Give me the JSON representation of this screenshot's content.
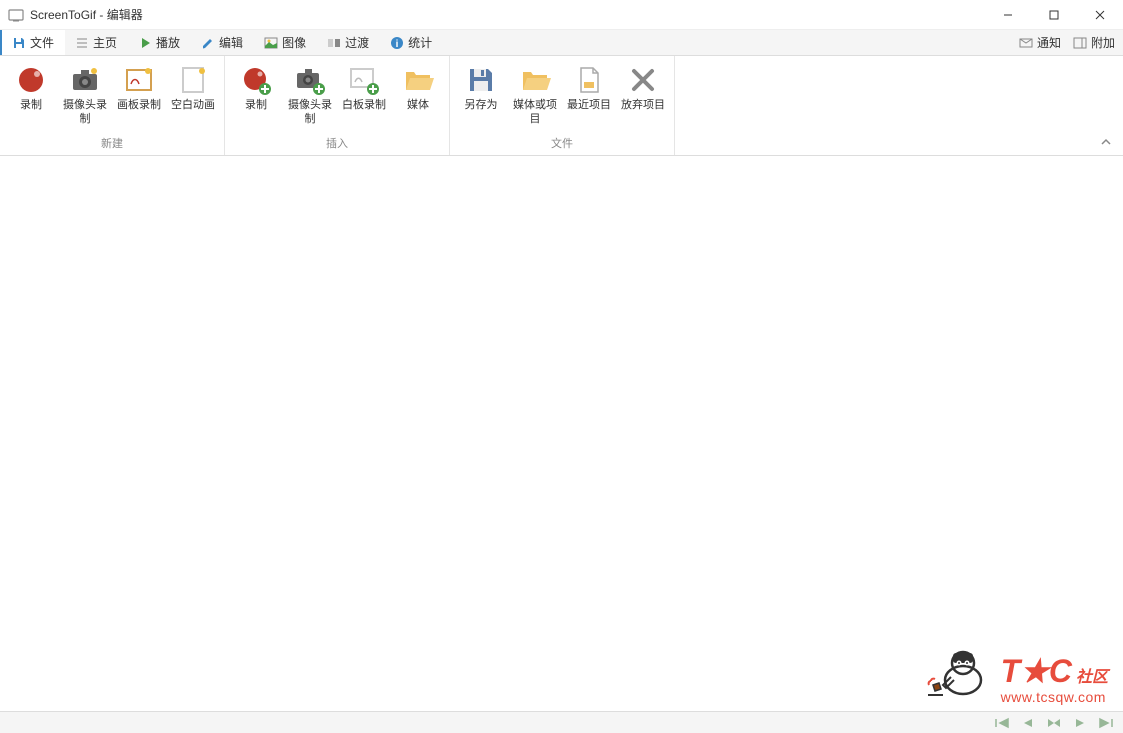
{
  "window": {
    "title": "ScreenToGif - 编辑器"
  },
  "tabs": {
    "file": "文件",
    "home": "主页",
    "play": "播放",
    "edit": "编辑",
    "image": "图像",
    "transition": "过渡",
    "stats": "统计",
    "notify": "通知",
    "attach": "附加"
  },
  "ribbon": {
    "groups": {
      "new": {
        "label": "新建",
        "buttons": {
          "record": "录制",
          "webcam": "摄像头录制",
          "board": "画板录制",
          "blank": "空白动画"
        }
      },
      "insert": {
        "label": "插入",
        "buttons": {
          "record": "录制",
          "webcam": "摄像头录制",
          "whiteboard": "白板录制",
          "media": "媒体"
        }
      },
      "file": {
        "label": "文件",
        "buttons": {
          "saveas": "另存为",
          "media_project": "媒体或项目",
          "recent": "最近项目",
          "discard": "放弃项目"
        }
      }
    }
  },
  "watermark": {
    "brand_main": "T★C",
    "brand_suffix": "社区",
    "url": "www.tcsqw.com"
  }
}
